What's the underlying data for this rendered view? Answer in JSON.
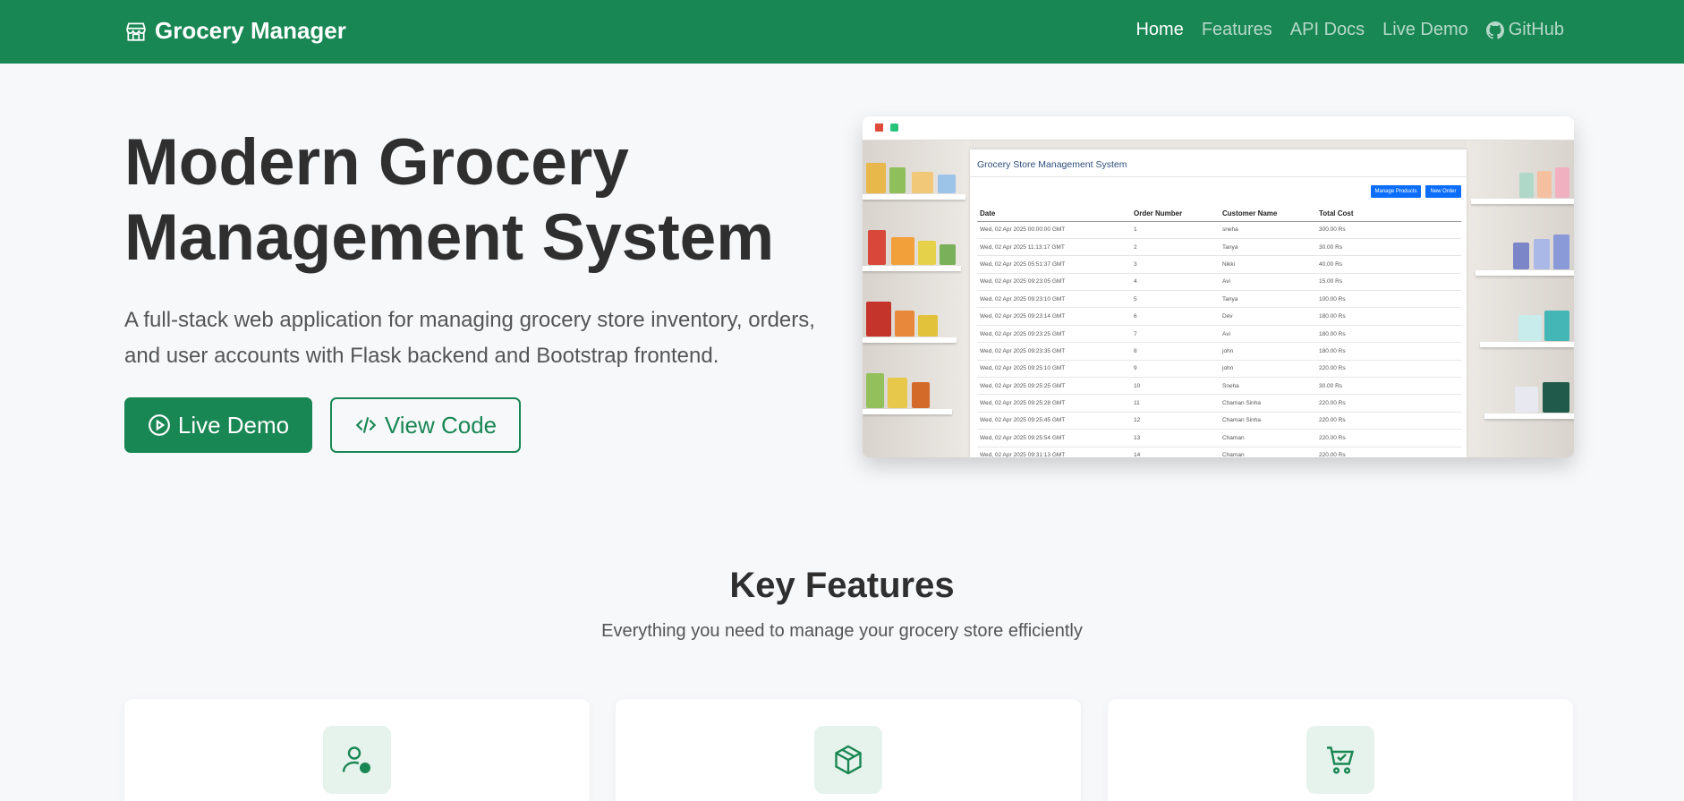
{
  "navbar": {
    "brand": "Grocery Manager",
    "brand_icon": "shop-icon",
    "links": [
      {
        "label": "Home",
        "active": true
      },
      {
        "label": "Features",
        "active": false
      },
      {
        "label": "API Docs",
        "active": false
      },
      {
        "label": "Live Demo",
        "active": false
      },
      {
        "label": "GitHub",
        "active": false,
        "icon": "github-icon"
      }
    ]
  },
  "hero": {
    "title_line1": "Modern Grocery",
    "title_line2": "Management System",
    "subtitle": "A full-stack web application for managing grocery store inventory, orders, and user accounts with Flask backend and Bootstrap frontend.",
    "primary_button": "Live Demo",
    "secondary_button": "View Code"
  },
  "screenshot": {
    "app_title": "Grocery Store Management System",
    "manage_products_label": "Manage Products",
    "new_order_label": "New Order",
    "columns": [
      "Date",
      "Order Number",
      "Customer Name",
      "Total Cost"
    ],
    "rows": [
      [
        "Wed, 02 Apr 2025 00:00:00 GMT",
        "1",
        "sneha",
        "300.00 Rs"
      ],
      [
        "Wed, 02 Apr 2025 11:13:17 GMT",
        "2",
        "Tanya",
        "30.00 Rs"
      ],
      [
        "Wed, 02 Apr 2025 05:51:37 GMT",
        "3",
        "Nikki",
        "40.00 Rs"
      ],
      [
        "Wed, 02 Apr 2025 09:23:05 GMT",
        "4",
        "Avi",
        "15.00 Rs"
      ],
      [
        "Wed, 02 Apr 2025 09:23:10 GMT",
        "5",
        "Tanya",
        "100.00 Rs"
      ],
      [
        "Wed, 02 Apr 2025 09:23:14 GMT",
        "6",
        "Dev",
        "180.00 Rs"
      ],
      [
        "Wed, 02 Apr 2025 09:23:25 GMT",
        "7",
        "Avi",
        "180.00 Rs"
      ],
      [
        "Wed, 02 Apr 2025 09:23:35 GMT",
        "8",
        "john",
        "180.00 Rs"
      ],
      [
        "Wed, 02 Apr 2025 09:25:10 GMT",
        "9",
        "john",
        "220.00 Rs"
      ],
      [
        "Wed, 02 Apr 2025 09:25:25 GMT",
        "10",
        "Sneha",
        "30.00 Rs"
      ],
      [
        "Wed, 02 Apr 2025 09:25:28 GMT",
        "11",
        "Chaman Sinha",
        "220.00 Rs"
      ],
      [
        "Wed, 02 Apr 2025 09:25:45 GMT",
        "12",
        "Chaman Sinha",
        "220.00 Rs"
      ],
      [
        "Wed, 02 Apr 2025 09:25:54 GMT",
        "13",
        "Chaman",
        "220.00 Rs"
      ],
      [
        "Wed, 02 Apr 2025 09:31:13 GMT",
        "14",
        "Chaman",
        "220.00 Rs"
      ]
    ]
  },
  "features": {
    "title": "Key Features",
    "subtitle": "Everything you need to manage your grocery store efficiently",
    "cards": [
      {
        "icon": "user-check-icon"
      },
      {
        "icon": "box-icon"
      },
      {
        "icon": "cart-check-icon"
      }
    ]
  },
  "colors": {
    "primary": "#198754",
    "background": "#f7f8fa",
    "icon_bg": "#e6f3ec"
  }
}
